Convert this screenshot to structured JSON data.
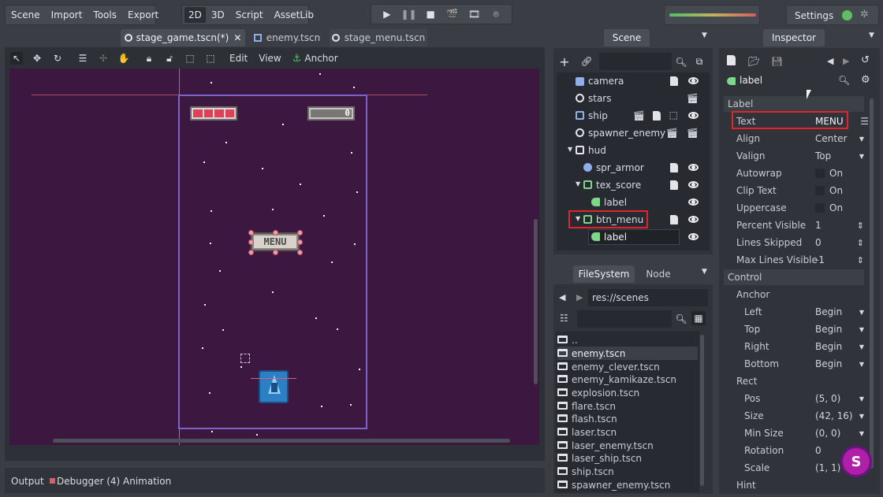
{
  "menu": [
    "Scene",
    "Import",
    "Tools",
    "Export"
  ],
  "workspaces": [
    "2D",
    "3D",
    "Script",
    "AssetLib"
  ],
  "active_workspace": "2D",
  "settings_label": "Settings",
  "scene_tabs": [
    "stage_game.tscn(*)",
    "enemy.tscn",
    "stage_menu.tscn"
  ],
  "toolbar": {
    "edit": "Edit",
    "view": "View",
    "anchor": "Anchor"
  },
  "viewport": {
    "hud_score": "0",
    "menu_button": "MENU"
  },
  "scene_panel": {
    "tab": "Scene",
    "nodes": [
      {
        "name": "camera",
        "icon": "camera-icon"
      },
      {
        "name": "stars",
        "icon": "node-icon"
      },
      {
        "name": "ship",
        "icon": "area2d-icon"
      },
      {
        "name": "spawner_enemy",
        "icon": "node-icon"
      },
      {
        "name": "hud",
        "icon": "canvaslayer-icon"
      },
      {
        "name": "spr_armor",
        "icon": "sprite-icon"
      },
      {
        "name": "tex_score",
        "icon": "texturerect-icon"
      },
      {
        "name": "label",
        "icon": "label-icon"
      },
      {
        "name": "btn_menu",
        "icon": "texturebutton-icon"
      },
      {
        "name": "label",
        "icon": "label-icon"
      }
    ]
  },
  "filesystem": {
    "tabs": [
      "FileSystem",
      "Node"
    ],
    "path": "res://scenes",
    "files": [
      "..",
      "enemy.tscn",
      "enemy_clever.tscn",
      "enemy_kamikaze.tscn",
      "explosion.tscn",
      "flare.tscn",
      "flash.tscn",
      "laser.tscn",
      "laser_enemy.tscn",
      "laser_ship.tscn",
      "ship.tscn",
      "spawner_enemy.tscn"
    ]
  },
  "inspector": {
    "tab": "Inspector",
    "node_name": "label",
    "sections": {
      "label": "Label",
      "control": "Control",
      "anchor": "Anchor",
      "rect": "Rect",
      "hint": "Hint"
    },
    "props": {
      "text": {
        "k": "Text",
        "v": "MENU"
      },
      "align": {
        "k": "Align",
        "v": "Center"
      },
      "valign": {
        "k": "Valign",
        "v": "Top"
      },
      "autowrap": {
        "k": "Autowrap",
        "v": "On"
      },
      "clip_text": {
        "k": "Clip Text",
        "v": "On"
      },
      "uppercase": {
        "k": "Uppercase",
        "v": "On"
      },
      "percent_visible": {
        "k": "Percent Visible",
        "v": "1"
      },
      "lines_skipped": {
        "k": "Lines Skipped",
        "v": "0"
      },
      "max_lines": {
        "k": "Max Lines Visible",
        "v": "-1"
      },
      "left": {
        "k": "Left",
        "v": "Begin"
      },
      "top": {
        "k": "Top",
        "v": "Begin"
      },
      "right": {
        "k": "Right",
        "v": "Begin"
      },
      "bottom": {
        "k": "Bottom",
        "v": "Begin"
      },
      "pos": {
        "k": "Pos",
        "v": "(5, 0)"
      },
      "size": {
        "k": "Size",
        "v": "(42, 16)"
      },
      "min_size": {
        "k": "Min Size",
        "v": "(0, 0)"
      },
      "rotation": {
        "k": "Rotation",
        "v": "0"
      },
      "scale": {
        "k": "Scale",
        "v": "(1, 1)"
      }
    }
  },
  "bottom": {
    "output": "Output",
    "debugger": "Debugger (4)",
    "animation": "Animation"
  },
  "colors": {
    "viewport_bg": "#3c1740",
    "highlight_red": "#e0262b",
    "accent_green": "#5fbf62"
  }
}
